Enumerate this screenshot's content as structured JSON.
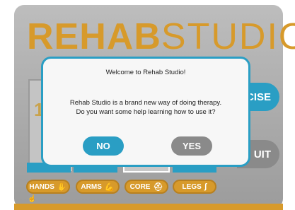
{
  "logo": {
    "bold": "REHAB",
    "thin": "STUDIO"
  },
  "background": {
    "digit": "1",
    "exercise_label": "RCISE",
    "quit_label": "UIT"
  },
  "categories": [
    {
      "label": "HANDS",
      "icon": "hand-icon"
    },
    {
      "label": "ARMS",
      "icon": "arm-icon"
    },
    {
      "label": "CORE",
      "icon": "torso-icon"
    },
    {
      "label": "LEGS",
      "icon": "leg-icon"
    }
  ],
  "dialog": {
    "title": "Welcome to Rehab Studio!",
    "body_line1": "Rehab Studio is a brand new way of doing therapy.",
    "body_line2": "Do you want some help learning how to use it?",
    "no_label": "NO",
    "yes_label": "YES"
  },
  "colors": {
    "accent": "#2a9ec4",
    "brand": "#d79a2b",
    "neutral_button": "#8a8a8a"
  }
}
